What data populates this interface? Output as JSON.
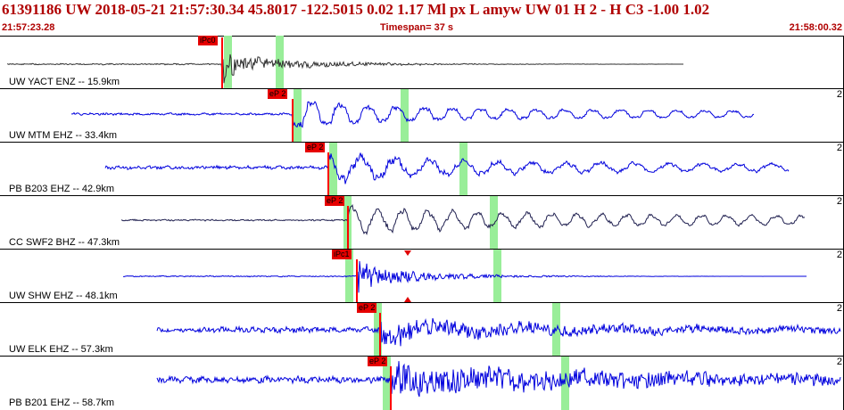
{
  "header": {
    "title": "61391186 UW 2018-05-21 21:57:30.34   45.8017 -122.5015   0.02  1.17 Ml  px  L amyw     UW 01  H   2  -  H C3   -1.00  1.02",
    "start_time": "21:57:23.28",
    "timespan": "Timespan=  37 s",
    "end_time": "21:58:00.32"
  },
  "colors": {
    "header_text": "#b00000",
    "trace_blue": "#0000dd",
    "trace_gray": "#303030",
    "trace_navy": "#202050",
    "pick_flag": "#e60000",
    "pick_line": "#ff0000",
    "green_band": "#99ee99"
  },
  "traces": [
    {
      "label": "UW YACT ENZ --  15.9km",
      "pick": "iPc0",
      "panel_num": "",
      "color": "trace_gray"
    },
    {
      "label": "UW MTM EHZ --  33.4km",
      "pick": "eP 2",
      "panel_num": "2",
      "color": "trace_blue"
    },
    {
      "label": "PB B203 EHZ --  42.9km",
      "pick": "eP 2",
      "panel_num": "2",
      "color": "trace_blue"
    },
    {
      "label": "CC SWF2 BHZ --  47.3km",
      "pick": "eP 2",
      "panel_num": "2",
      "color": "trace_navy"
    },
    {
      "label": "UW SHW EHZ --  48.1km",
      "pick": "iPc1",
      "panel_num": "2",
      "color": "trace_blue"
    },
    {
      "label": "UW ELK EHZ --  57.3km",
      "pick": "eP 2",
      "panel_num": "2",
      "color": "trace_blue"
    },
    {
      "label": "PB B201 EHZ --  58.7km",
      "pick": "eP 2",
      "panel_num": "2",
      "color": "trace_blue"
    }
  ]
}
